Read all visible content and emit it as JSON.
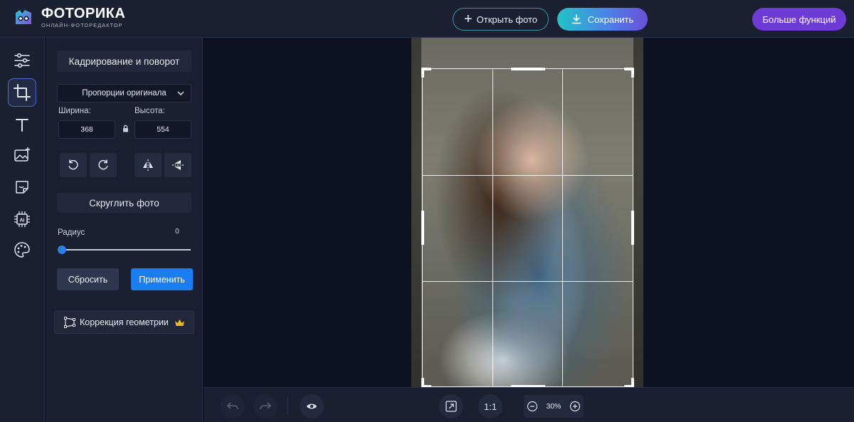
{
  "app": {
    "title": "ФОТОРИКА",
    "subtitle": "ОНЛАЙН-ФОТОРЕДАКТОР"
  },
  "header": {
    "open_label": "Открыть фото",
    "save_label": "Сохранить",
    "more_label": "Больше функций"
  },
  "toolbar": {
    "items": [
      {
        "icon": "adjust-sliders-icon"
      },
      {
        "icon": "crop-icon",
        "active": true
      },
      {
        "icon": "text-icon"
      },
      {
        "icon": "image-add-icon"
      },
      {
        "icon": "sticker-icon"
      },
      {
        "icon": "ai-chip-icon"
      },
      {
        "icon": "palette-icon"
      }
    ]
  },
  "crop_panel": {
    "title": "Кадрирование и поворот",
    "proportion_value": "Пропорции оригинала",
    "width_label": "Ширина:",
    "height_label": "Высота:",
    "width_value": "368",
    "height_value": "554"
  },
  "round_panel": {
    "title": "Скруглить фото",
    "radius_label": "Радиус",
    "radius_value": "0",
    "reset_label": "Сбросить",
    "apply_label": "Применить"
  },
  "geometry": {
    "label": "Коррекция геометрии"
  },
  "bottom": {
    "ratio_label": "1:1",
    "zoom_value": "30%"
  },
  "colors": {
    "accent_blue": "#1a7ef0",
    "accent_purple": "#6f3bd6",
    "panel_bg": "#1b2030",
    "canvas_bg": "#0e1220"
  }
}
